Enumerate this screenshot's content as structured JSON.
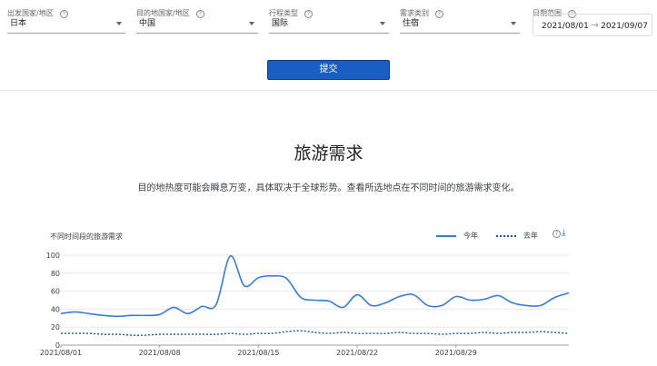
{
  "filters": {
    "origin": {
      "label": "出发国家/地区",
      "value": "日本"
    },
    "destination": {
      "label": "目的地国家/地区",
      "value": "中国"
    },
    "trip_type": {
      "label": "行程类型",
      "value": "国际"
    },
    "demand_type": {
      "label": "需求类别",
      "value": "住宿"
    },
    "date_range": {
      "label": "日期范围",
      "start": "2021/08/01",
      "end": "2021/09/07"
    }
  },
  "submit_label": "提交",
  "section": {
    "title": "旅游需求",
    "subtitle": "目的地热度可能会瞬息万变，具体取决于全球形势。查看所选地点在不同时间的旅游需求变化。"
  },
  "chart": {
    "heading": "不同时间段的旅游需求",
    "legend_this_year": "今年",
    "legend_last_year": "去年",
    "colors": {
      "this_year": "#3a7bd5",
      "last_year": "#1a4fa8"
    }
  },
  "chart_data": {
    "type": "line",
    "title": "不同时间段的旅游需求",
    "xlabel": "",
    "ylabel": "",
    "ylim": [
      0,
      100
    ],
    "yticks": [
      0,
      20,
      40,
      60,
      80,
      100
    ],
    "x_tick_labels": [
      "2021/08/01",
      "2021/08/08",
      "2021/08/15",
      "2021/08/22",
      "2021/08/29"
    ],
    "x": [
      "2021/08/01",
      "2021/08/02",
      "2021/08/03",
      "2021/08/04",
      "2021/08/05",
      "2021/08/06",
      "2021/08/07",
      "2021/08/08",
      "2021/08/09",
      "2021/08/10",
      "2021/08/11",
      "2021/08/12",
      "2021/08/13",
      "2021/08/14",
      "2021/08/15",
      "2021/08/16",
      "2021/08/17",
      "2021/08/18",
      "2021/08/19",
      "2021/08/20",
      "2021/08/21",
      "2021/08/22",
      "2021/08/23",
      "2021/08/24",
      "2021/08/25",
      "2021/08/26",
      "2021/08/27",
      "2021/08/28",
      "2021/08/29",
      "2021/08/30",
      "2021/08/31",
      "2021/09/01",
      "2021/09/02",
      "2021/09/03",
      "2021/09/04",
      "2021/09/05",
      "2021/09/06"
    ],
    "grid": true,
    "legend": "top-right",
    "series": [
      {
        "name": "今年",
        "style": "solid",
        "values": [
          35,
          37,
          35,
          33,
          32,
          33,
          33,
          34,
          42,
          35,
          43,
          45,
          99,
          66,
          75,
          77,
          74,
          53,
          50,
          49,
          42,
          56,
          44,
          47,
          54,
          56,
          44,
          44,
          54,
          50,
          51,
          55,
          47,
          44,
          44,
          53,
          58
        ]
      },
      {
        "name": "去年",
        "style": "dotted",
        "values": [
          13,
          13,
          13,
          12,
          12,
          11,
          11,
          12,
          12,
          12,
          12,
          12,
          13,
          12,
          13,
          13,
          15,
          16,
          14,
          13,
          14,
          13,
          13,
          13,
          14,
          13,
          13,
          12,
          13,
          13,
          14,
          13,
          14,
          14,
          15,
          14,
          13
        ]
      }
    ]
  }
}
